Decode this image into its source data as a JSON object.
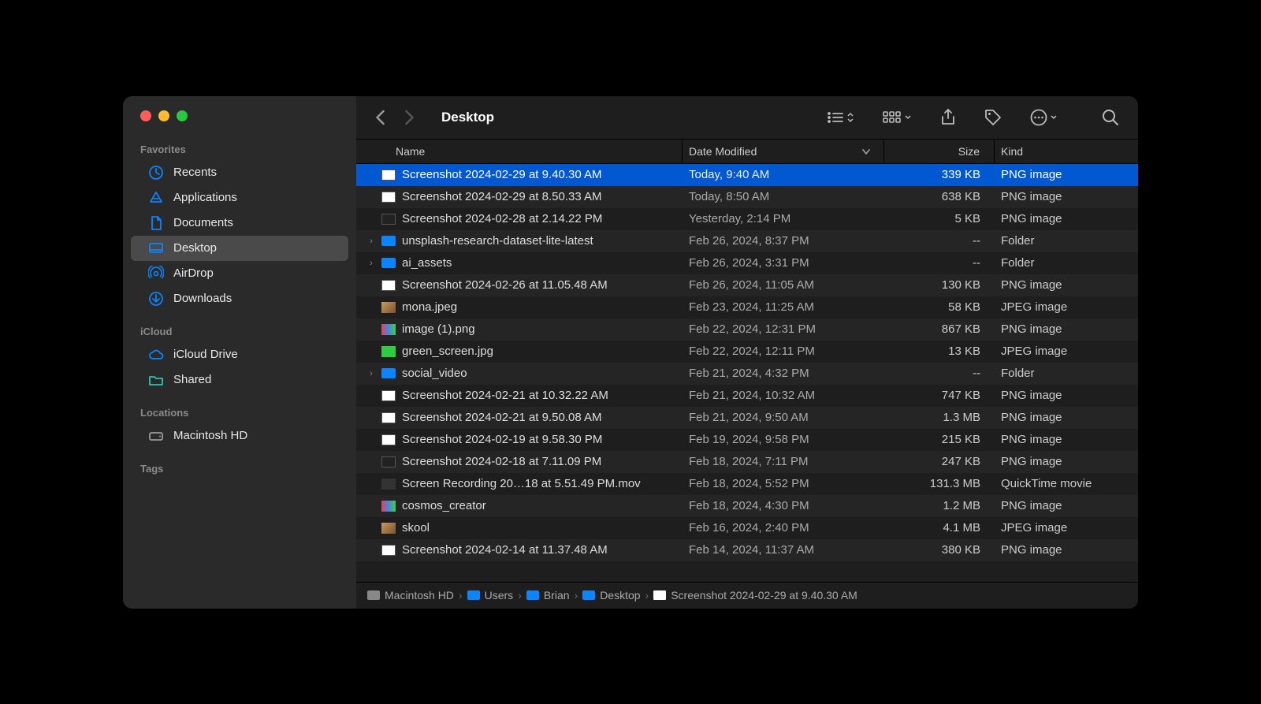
{
  "window_title": "Desktop",
  "sidebar": {
    "sections": [
      {
        "header": "Favorites",
        "items": [
          {
            "icon": "recents",
            "label": "Recents",
            "active": false
          },
          {
            "icon": "applications",
            "label": "Applications",
            "active": false
          },
          {
            "icon": "documents",
            "label": "Documents",
            "active": false
          },
          {
            "icon": "desktop",
            "label": "Desktop",
            "active": true
          },
          {
            "icon": "airdrop",
            "label": "AirDrop",
            "active": false
          },
          {
            "icon": "downloads",
            "label": "Downloads",
            "active": false
          }
        ]
      },
      {
        "header": "iCloud",
        "items": [
          {
            "icon": "icloud",
            "label": "iCloud Drive",
            "active": false
          },
          {
            "icon": "shared",
            "label": "Shared",
            "active": false
          }
        ]
      },
      {
        "header": "Locations",
        "items": [
          {
            "icon": "disk",
            "label": "Macintosh HD",
            "active": false
          }
        ]
      },
      {
        "header": "Tags",
        "items": []
      }
    ]
  },
  "columns": {
    "name": "Name",
    "date": "Date Modified",
    "size": "Size",
    "kind": "Kind"
  },
  "files": [
    {
      "disclosure": "",
      "icon": "png",
      "name": "Screenshot 2024-02-29 at 9.40.30 AM",
      "date": "Today, 9:40 AM",
      "size": "339 KB",
      "kind": "PNG image",
      "selected": true
    },
    {
      "disclosure": "",
      "icon": "png",
      "name": "Screenshot 2024-02-29 at 8.50.33 AM",
      "date": "Today, 8:50 AM",
      "size": "638 KB",
      "kind": "PNG image",
      "selected": false
    },
    {
      "disclosure": "",
      "icon": "dark",
      "name": "Screenshot 2024-02-28 at 2.14.22 PM",
      "date": "Yesterday, 2:14 PM",
      "size": "5 KB",
      "kind": "PNG image",
      "selected": false
    },
    {
      "disclosure": ">",
      "icon": "folder",
      "name": "unsplash-research-dataset-lite-latest",
      "date": "Feb 26, 2024, 8:37 PM",
      "size": "--",
      "kind": "Folder",
      "selected": false
    },
    {
      "disclosure": ">",
      "icon": "folder",
      "name": "ai_assets",
      "date": "Feb 26, 2024, 3:31 PM",
      "size": "--",
      "kind": "Folder",
      "selected": false
    },
    {
      "disclosure": "",
      "icon": "png",
      "name": "Screenshot 2024-02-26 at 11.05.48 AM",
      "date": "Feb 26, 2024, 11:05 AM",
      "size": "130 KB",
      "kind": "PNG image",
      "selected": false
    },
    {
      "disclosure": "",
      "icon": "jpeg",
      "name": "mona.jpeg",
      "date": "Feb 23, 2024, 11:25 AM",
      "size": "58 KB",
      "kind": "JPEG image",
      "selected": false
    },
    {
      "disclosure": "",
      "icon": "mixed",
      "name": "image (1).png",
      "date": "Feb 22, 2024, 12:31 PM",
      "size": "867 KB",
      "kind": "PNG image",
      "selected": false
    },
    {
      "disclosure": "",
      "icon": "green",
      "name": "green_screen.jpg",
      "date": "Feb 22, 2024, 12:11 PM",
      "size": "13 KB",
      "kind": "JPEG image",
      "selected": false
    },
    {
      "disclosure": ">",
      "icon": "folder",
      "name": "social_video",
      "date": "Feb 21, 2024, 4:32 PM",
      "size": "--",
      "kind": "Folder",
      "selected": false
    },
    {
      "disclosure": "",
      "icon": "png",
      "name": "Screenshot 2024-02-21 at 10.32.22 AM",
      "date": "Feb 21, 2024, 10:32 AM",
      "size": "747 KB",
      "kind": "PNG image",
      "selected": false
    },
    {
      "disclosure": "",
      "icon": "png",
      "name": "Screenshot 2024-02-21 at 9.50.08 AM",
      "date": "Feb 21, 2024, 9:50 AM",
      "size": "1.3 MB",
      "kind": "PNG image",
      "selected": false
    },
    {
      "disclosure": "",
      "icon": "png",
      "name": "Screenshot 2024-02-19 at 9.58.30 PM",
      "date": "Feb 19, 2024, 9:58 PM",
      "size": "215 KB",
      "kind": "PNG image",
      "selected": false
    },
    {
      "disclosure": "",
      "icon": "dark",
      "name": "Screenshot 2024-02-18 at 7.11.09 PM",
      "date": "Feb 18, 2024, 7:11 PM",
      "size": "247 KB",
      "kind": "PNG image",
      "selected": false
    },
    {
      "disclosure": "",
      "icon": "movie",
      "name": "Screen Recording 20…18 at 5.51.49 PM.mov",
      "date": "Feb 18, 2024, 5:52 PM",
      "size": "131.3 MB",
      "kind": "QuickTime movie",
      "selected": false
    },
    {
      "disclosure": "",
      "icon": "mixed",
      "name": "cosmos_creator",
      "date": "Feb 18, 2024, 4:30 PM",
      "size": "1.2 MB",
      "kind": "PNG image",
      "selected": false
    },
    {
      "disclosure": "",
      "icon": "jpeg",
      "name": "skool",
      "date": "Feb 16, 2024, 2:40 PM",
      "size": "4.1 MB",
      "kind": "JPEG image",
      "selected": false
    },
    {
      "disclosure": "",
      "icon": "png",
      "name": "Screenshot 2024-02-14 at 11.37.48 AM",
      "date": "Feb 14, 2024, 11:37 AM",
      "size": "380 KB",
      "kind": "PNG image",
      "selected": false
    }
  ],
  "pathbar": [
    {
      "icon": "disk",
      "label": "Macintosh HD"
    },
    {
      "icon": "folder",
      "label": "Users"
    },
    {
      "icon": "folder",
      "label": "Brian"
    },
    {
      "icon": "folder",
      "label": "Desktop"
    },
    {
      "icon": "file",
      "label": "Screenshot 2024-02-29 at 9.40.30 AM"
    }
  ]
}
